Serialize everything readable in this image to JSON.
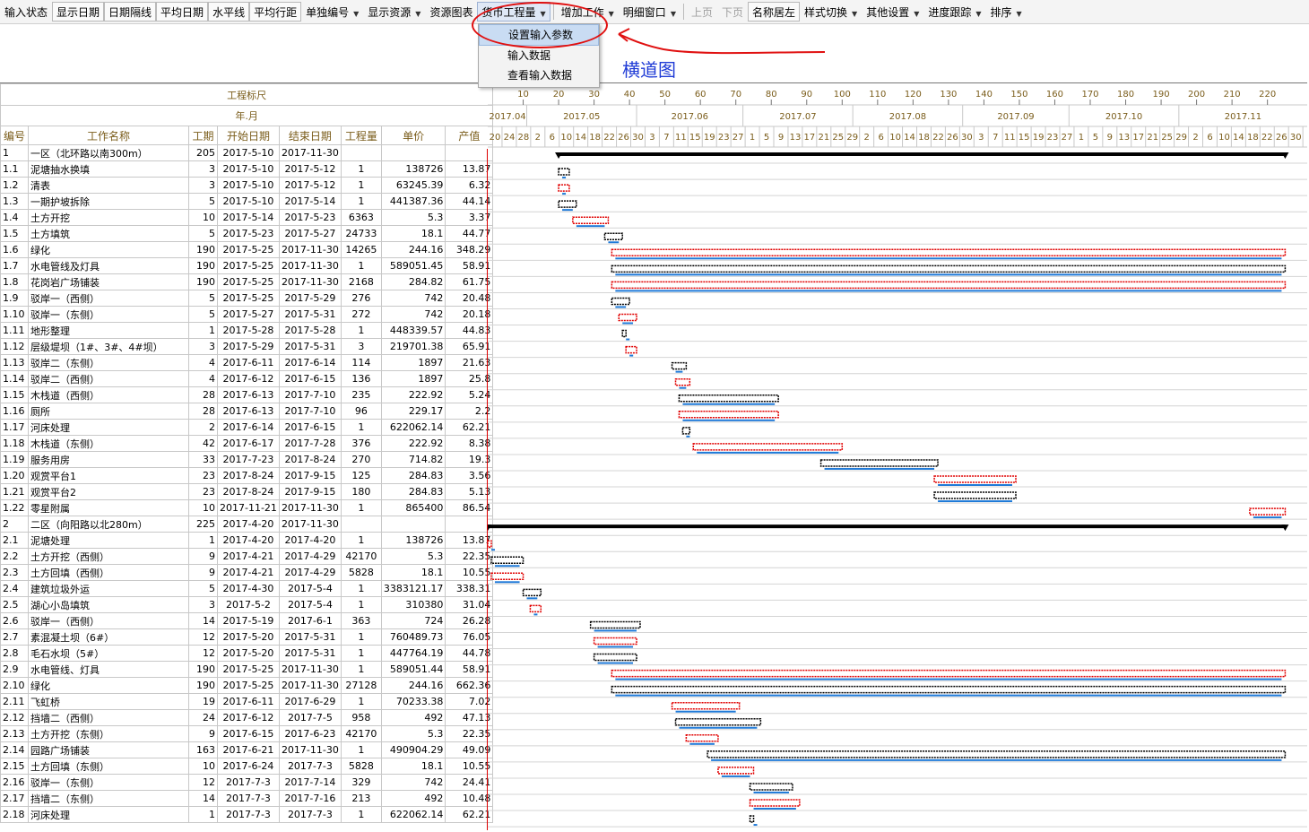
{
  "toolbar": [
    {
      "label": "输入状态",
      "style": "plain"
    },
    {
      "label": "显示日期",
      "style": "boxed"
    },
    {
      "label": "日期隔线",
      "style": "boxed"
    },
    {
      "label": "平均日期",
      "style": "boxed"
    },
    {
      "label": "水平线",
      "style": "boxed"
    },
    {
      "label": "平均行距",
      "style": "boxed"
    },
    {
      "label": "单独编号",
      "style": "menu"
    },
    {
      "label": "显示资源",
      "style": "menu"
    },
    {
      "label": "资源图表",
      "style": "plain"
    },
    {
      "label": "货币工程量",
      "style": "menu-active"
    },
    {
      "label": "增加工作",
      "style": "menu"
    },
    {
      "label": "明细窗口",
      "style": "menu"
    },
    {
      "label": "上页",
      "style": "disabled"
    },
    {
      "label": "下页",
      "style": "disabled"
    },
    {
      "label": "名称居左",
      "style": "boxed"
    },
    {
      "label": "样式切换",
      "style": "menu"
    },
    {
      "label": "其他设置",
      "style": "menu"
    },
    {
      "label": "进度跟踪",
      "style": "menu"
    },
    {
      "label": "排序",
      "style": "menu"
    }
  ],
  "dropdown": {
    "items": [
      "设置输入参数",
      "输入数据",
      "查看输入数据"
    ],
    "highlighted": 0
  },
  "annotation": {
    "text": "横道图",
    "color": "#1f3bd6",
    "circle_color": "#e01010"
  },
  "grid": {
    "scale_label": "工程标尺",
    "month_label": "年.月",
    "columns": [
      "编号",
      "工作名称",
      "工期",
      "开始日期",
      "结束日期",
      "工程量",
      "单价",
      "产值"
    ],
    "scale_ticks": [
      "10",
      "20",
      "30",
      "40",
      "50",
      "60",
      "70",
      "80",
      "90",
      "100",
      "110",
      "120",
      "130",
      "140",
      "150",
      "160",
      "170",
      "180",
      "190",
      "200",
      "210",
      "220"
    ],
    "months": [
      "2017.04",
      "2017.05",
      "2017.06",
      "2017.07",
      "2017.08",
      "2017.09",
      "2017.10",
      "2017.11"
    ],
    "day_ticks": [
      "20",
      "24",
      "28",
      "2",
      "6",
      "10",
      "14",
      "18",
      "22",
      "26",
      "30",
      "3",
      "7",
      "11",
      "15",
      "19",
      "23",
      "27",
      "1",
      "5",
      "9",
      "13",
      "17",
      "21",
      "25",
      "29",
      "2",
      "6",
      "10",
      "14",
      "18",
      "22",
      "26",
      "30",
      "3",
      "7",
      "11",
      "15",
      "19",
      "23",
      "27",
      "1",
      "5",
      "9",
      "13",
      "17",
      "21",
      "25",
      "29",
      "2",
      "6",
      "10",
      "14",
      "18",
      "22",
      "26",
      "30"
    ],
    "rows": [
      {
        "id": "1",
        "name": "一区（北环路以南300m）",
        "dur": "205",
        "start": "2017-5-10",
        "end": "2017-11-30",
        "qty": "",
        "price": "",
        "value": "",
        "level": 1,
        "s": 20,
        "d": 205,
        "kind": "summary"
      },
      {
        "id": "1.1",
        "name": "泥塘抽水换填",
        "dur": "3",
        "start": "2017-5-10",
        "end": "2017-5-12",
        "qty": "1",
        "price": "138726",
        "value": "13.87",
        "level": 2,
        "s": 20,
        "d": 3,
        "kind": "task"
      },
      {
        "id": "1.2",
        "name": "清表",
        "dur": "3",
        "start": "2017-5-10",
        "end": "2017-5-12",
        "qty": "1",
        "price": "63245.39",
        "value": "6.32",
        "level": 2,
        "s": 20,
        "d": 3,
        "kind": "task"
      },
      {
        "id": "1.3",
        "name": "一期护坡拆除",
        "dur": "5",
        "start": "2017-5-10",
        "end": "2017-5-14",
        "qty": "1",
        "price": "441387.36",
        "value": "44.14",
        "level": 2,
        "s": 20,
        "d": 5,
        "kind": "task"
      },
      {
        "id": "1.4",
        "name": "土方开挖",
        "dur": "10",
        "start": "2017-5-14",
        "end": "2017-5-23",
        "qty": "6363",
        "price": "5.3",
        "value": "3.37",
        "level": 2,
        "s": 24,
        "d": 10,
        "kind": "task"
      },
      {
        "id": "1.5",
        "name": "土方填筑",
        "dur": "5",
        "start": "2017-5-23",
        "end": "2017-5-27",
        "qty": "24733",
        "price": "18.1",
        "value": "44.77",
        "level": 2,
        "s": 33,
        "d": 5,
        "kind": "task"
      },
      {
        "id": "1.6",
        "name": "绿化",
        "dur": "190",
        "start": "2017-5-25",
        "end": "2017-11-30",
        "qty": "14265",
        "price": "244.16",
        "value": "348.29",
        "level": 2,
        "s": 35,
        "d": 190,
        "kind": "task"
      },
      {
        "id": "1.7",
        "name": "水电管线及灯具",
        "dur": "190",
        "start": "2017-5-25",
        "end": "2017-11-30",
        "qty": "1",
        "price": "589051.45",
        "value": "58.91",
        "level": 2,
        "s": 35,
        "d": 190,
        "kind": "task"
      },
      {
        "id": "1.8",
        "name": "花岗岩广场铺装",
        "dur": "190",
        "start": "2017-5-25",
        "end": "2017-11-30",
        "qty": "2168",
        "price": "284.82",
        "value": "61.75",
        "level": 2,
        "s": 35,
        "d": 190,
        "kind": "task"
      },
      {
        "id": "1.9",
        "name": "驳岸一（西侧）",
        "dur": "5",
        "start": "2017-5-25",
        "end": "2017-5-29",
        "qty": "276",
        "price": "742",
        "value": "20.48",
        "level": 2,
        "s": 35,
        "d": 5,
        "kind": "task"
      },
      {
        "id": "1.10",
        "name": "驳岸一（东侧）",
        "dur": "5",
        "start": "2017-5-27",
        "end": "2017-5-31",
        "qty": "272",
        "price": "742",
        "value": "20.18",
        "level": 2,
        "s": 37,
        "d": 5,
        "kind": "task"
      },
      {
        "id": "1.11",
        "name": "地形整理",
        "dur": "1",
        "start": "2017-5-28",
        "end": "2017-5-28",
        "qty": "1",
        "price": "448339.57",
        "value": "44.83",
        "level": 2,
        "s": 38,
        "d": 1,
        "kind": "task"
      },
      {
        "id": "1.12",
        "name": "层级堤坝（1#、3#、4#坝）",
        "dur": "3",
        "start": "2017-5-29",
        "end": "2017-5-31",
        "qty": "3",
        "price": "219701.38",
        "value": "65.91",
        "level": 2,
        "s": 39,
        "d": 3,
        "kind": "task"
      },
      {
        "id": "1.13",
        "name": "驳岸二（东侧）",
        "dur": "4",
        "start": "2017-6-11",
        "end": "2017-6-14",
        "qty": "114",
        "price": "1897",
        "value": "21.63",
        "level": 2,
        "s": 52,
        "d": 4,
        "kind": "task"
      },
      {
        "id": "1.14",
        "name": "驳岸二（西侧）",
        "dur": "4",
        "start": "2017-6-12",
        "end": "2017-6-15",
        "qty": "136",
        "price": "1897",
        "value": "25.8",
        "level": 2,
        "s": 53,
        "d": 4,
        "kind": "task"
      },
      {
        "id": "1.15",
        "name": "木栈道（西侧）",
        "dur": "28",
        "start": "2017-6-13",
        "end": "2017-7-10",
        "qty": "235",
        "price": "222.92",
        "value": "5.24",
        "level": 2,
        "s": 54,
        "d": 28,
        "kind": "task"
      },
      {
        "id": "1.16",
        "name": "厕所",
        "dur": "28",
        "start": "2017-6-13",
        "end": "2017-7-10",
        "qty": "96",
        "price": "229.17",
        "value": "2.2",
        "level": 2,
        "s": 54,
        "d": 28,
        "kind": "task"
      },
      {
        "id": "1.17",
        "name": "河床处理",
        "dur": "2",
        "start": "2017-6-14",
        "end": "2017-6-15",
        "qty": "1",
        "price": "622062.14",
        "value": "62.21",
        "level": 2,
        "s": 55,
        "d": 2,
        "kind": "task"
      },
      {
        "id": "1.18",
        "name": "木栈道（东侧）",
        "dur": "42",
        "start": "2017-6-17",
        "end": "2017-7-28",
        "qty": "376",
        "price": "222.92",
        "value": "8.38",
        "level": 2,
        "s": 58,
        "d": 42,
        "kind": "task"
      },
      {
        "id": "1.19",
        "name": "服务用房",
        "dur": "33",
        "start": "2017-7-23",
        "end": "2017-8-24",
        "qty": "270",
        "price": "714.82",
        "value": "19.3",
        "level": 2,
        "s": 94,
        "d": 33,
        "kind": "task"
      },
      {
        "id": "1.20",
        "name": "观赏平台1",
        "dur": "23",
        "start": "2017-8-24",
        "end": "2017-9-15",
        "qty": "125",
        "price": "284.83",
        "value": "3.56",
        "level": 2,
        "s": 126,
        "d": 23,
        "kind": "task"
      },
      {
        "id": "1.21",
        "name": "观赏平台2",
        "dur": "23",
        "start": "2017-8-24",
        "end": "2017-9-15",
        "qty": "180",
        "price": "284.83",
        "value": "5.13",
        "level": 2,
        "s": 126,
        "d": 23,
        "kind": "task"
      },
      {
        "id": "1.22",
        "name": "零星附属",
        "dur": "10",
        "start": "2017-11-21",
        "end": "2017-11-30",
        "qty": "1",
        "price": "865400",
        "value": "86.54",
        "level": 2,
        "s": 215,
        "d": 10,
        "kind": "task"
      },
      {
        "id": "2",
        "name": "二区（向阳路以北280m）",
        "dur": "225",
        "start": "2017-4-20",
        "end": "2017-11-30",
        "qty": "",
        "price": "",
        "value": "",
        "level": 1,
        "s": 0,
        "d": 225,
        "kind": "summary"
      },
      {
        "id": "2.1",
        "name": "泥塘处理",
        "dur": "1",
        "start": "2017-4-20",
        "end": "2017-4-20",
        "qty": "1",
        "price": "138726",
        "value": "13.87",
        "level": 2,
        "s": 0,
        "d": 1,
        "kind": "task"
      },
      {
        "id": "2.2",
        "name": "土方开挖（西侧）",
        "dur": "9",
        "start": "2017-4-21",
        "end": "2017-4-29",
        "qty": "42170",
        "price": "5.3",
        "value": "22.35",
        "level": 2,
        "s": 1,
        "d": 9,
        "kind": "task"
      },
      {
        "id": "2.3",
        "name": "土方回填（西侧）",
        "dur": "9",
        "start": "2017-4-21",
        "end": "2017-4-29",
        "qty": "5828",
        "price": "18.1",
        "value": "10.55",
        "level": 2,
        "s": 1,
        "d": 9,
        "kind": "task"
      },
      {
        "id": "2.4",
        "name": "建筑垃圾外运",
        "dur": "5",
        "start": "2017-4-30",
        "end": "2017-5-4",
        "qty": "1",
        "price": "3383121.17",
        "value": "338.31",
        "level": 2,
        "s": 10,
        "d": 5,
        "kind": "task"
      },
      {
        "id": "2.5",
        "name": "湖心小岛填筑",
        "dur": "3",
        "start": "2017-5-2",
        "end": "2017-5-4",
        "qty": "1",
        "price": "310380",
        "value": "31.04",
        "level": 2,
        "s": 12,
        "d": 3,
        "kind": "task"
      },
      {
        "id": "2.6",
        "name": "驳岸一（西侧）",
        "dur": "14",
        "start": "2017-5-19",
        "end": "2017-6-1",
        "qty": "363",
        "price": "724",
        "value": "26.28",
        "level": 2,
        "s": 29,
        "d": 14,
        "kind": "task"
      },
      {
        "id": "2.7",
        "name": "素混凝土坝（6#）",
        "dur": "12",
        "start": "2017-5-20",
        "end": "2017-5-31",
        "qty": "1",
        "price": "760489.73",
        "value": "76.05",
        "level": 2,
        "s": 30,
        "d": 12,
        "kind": "task"
      },
      {
        "id": "2.8",
        "name": "毛石水坝（5#）",
        "dur": "12",
        "start": "2017-5-20",
        "end": "2017-5-31",
        "qty": "1",
        "price": "447764.19",
        "value": "44.78",
        "level": 2,
        "s": 30,
        "d": 12,
        "kind": "task"
      },
      {
        "id": "2.9",
        "name": "水电管线、灯具",
        "dur": "190",
        "start": "2017-5-25",
        "end": "2017-11-30",
        "qty": "1",
        "price": "589051.44",
        "value": "58.91",
        "level": 2,
        "s": 35,
        "d": 190,
        "kind": "task"
      },
      {
        "id": "2.10",
        "name": "绿化",
        "dur": "190",
        "start": "2017-5-25",
        "end": "2017-11-30",
        "qty": "27128",
        "price": "244.16",
        "value": "662.36",
        "level": 2,
        "s": 35,
        "d": 190,
        "kind": "task"
      },
      {
        "id": "2.11",
        "name": "飞虹桥",
        "dur": "19",
        "start": "2017-6-11",
        "end": "2017-6-29",
        "qty": "1",
        "price": "70233.38",
        "value": "7.02",
        "level": 2,
        "s": 52,
        "d": 19,
        "kind": "task"
      },
      {
        "id": "2.12",
        "name": "挡墙二（西侧）",
        "dur": "24",
        "start": "2017-6-12",
        "end": "2017-7-5",
        "qty": "958",
        "price": "492",
        "value": "47.13",
        "level": 2,
        "s": 53,
        "d": 24,
        "kind": "task"
      },
      {
        "id": "2.13",
        "name": "土方开挖（东侧）",
        "dur": "9",
        "start": "2017-6-15",
        "end": "2017-6-23",
        "qty": "42170",
        "price": "5.3",
        "value": "22.35",
        "level": 2,
        "s": 56,
        "d": 9,
        "kind": "task"
      },
      {
        "id": "2.14",
        "name": "园路广场铺装",
        "dur": "163",
        "start": "2017-6-21",
        "end": "2017-11-30",
        "qty": "1",
        "price": "490904.29",
        "value": "49.09",
        "level": 2,
        "s": 62,
        "d": 163,
        "kind": "task"
      },
      {
        "id": "2.15",
        "name": "土方回填（东侧）",
        "dur": "10",
        "start": "2017-6-24",
        "end": "2017-7-3",
        "qty": "5828",
        "price": "18.1",
        "value": "10.55",
        "level": 2,
        "s": 65,
        "d": 10,
        "kind": "task"
      },
      {
        "id": "2.16",
        "name": "驳岸一（东侧）",
        "dur": "12",
        "start": "2017-7-3",
        "end": "2017-7-14",
        "qty": "329",
        "price": "742",
        "value": "24.41",
        "level": 2,
        "s": 74,
        "d": 12,
        "kind": "task"
      },
      {
        "id": "2.17",
        "name": "挡墙二（东侧）",
        "dur": "14",
        "start": "2017-7-3",
        "end": "2017-7-16",
        "qty": "213",
        "price": "492",
        "value": "10.48",
        "level": 2,
        "s": 74,
        "d": 14,
        "kind": "task"
      },
      {
        "id": "2.18",
        "name": "河床处理",
        "dur": "1",
        "start": "2017-7-3",
        "end": "2017-7-3",
        "qty": "1",
        "price": "622062.14",
        "value": "62.21",
        "level": 2,
        "s": 74,
        "d": 1,
        "kind": "task"
      }
    ]
  },
  "colors": {
    "header_text": "#7a5c1a",
    "bar_black": "#000000",
    "bar_red": "#e00000",
    "bar_blue": "#1f7ad8",
    "today_line": "#d00000"
  }
}
